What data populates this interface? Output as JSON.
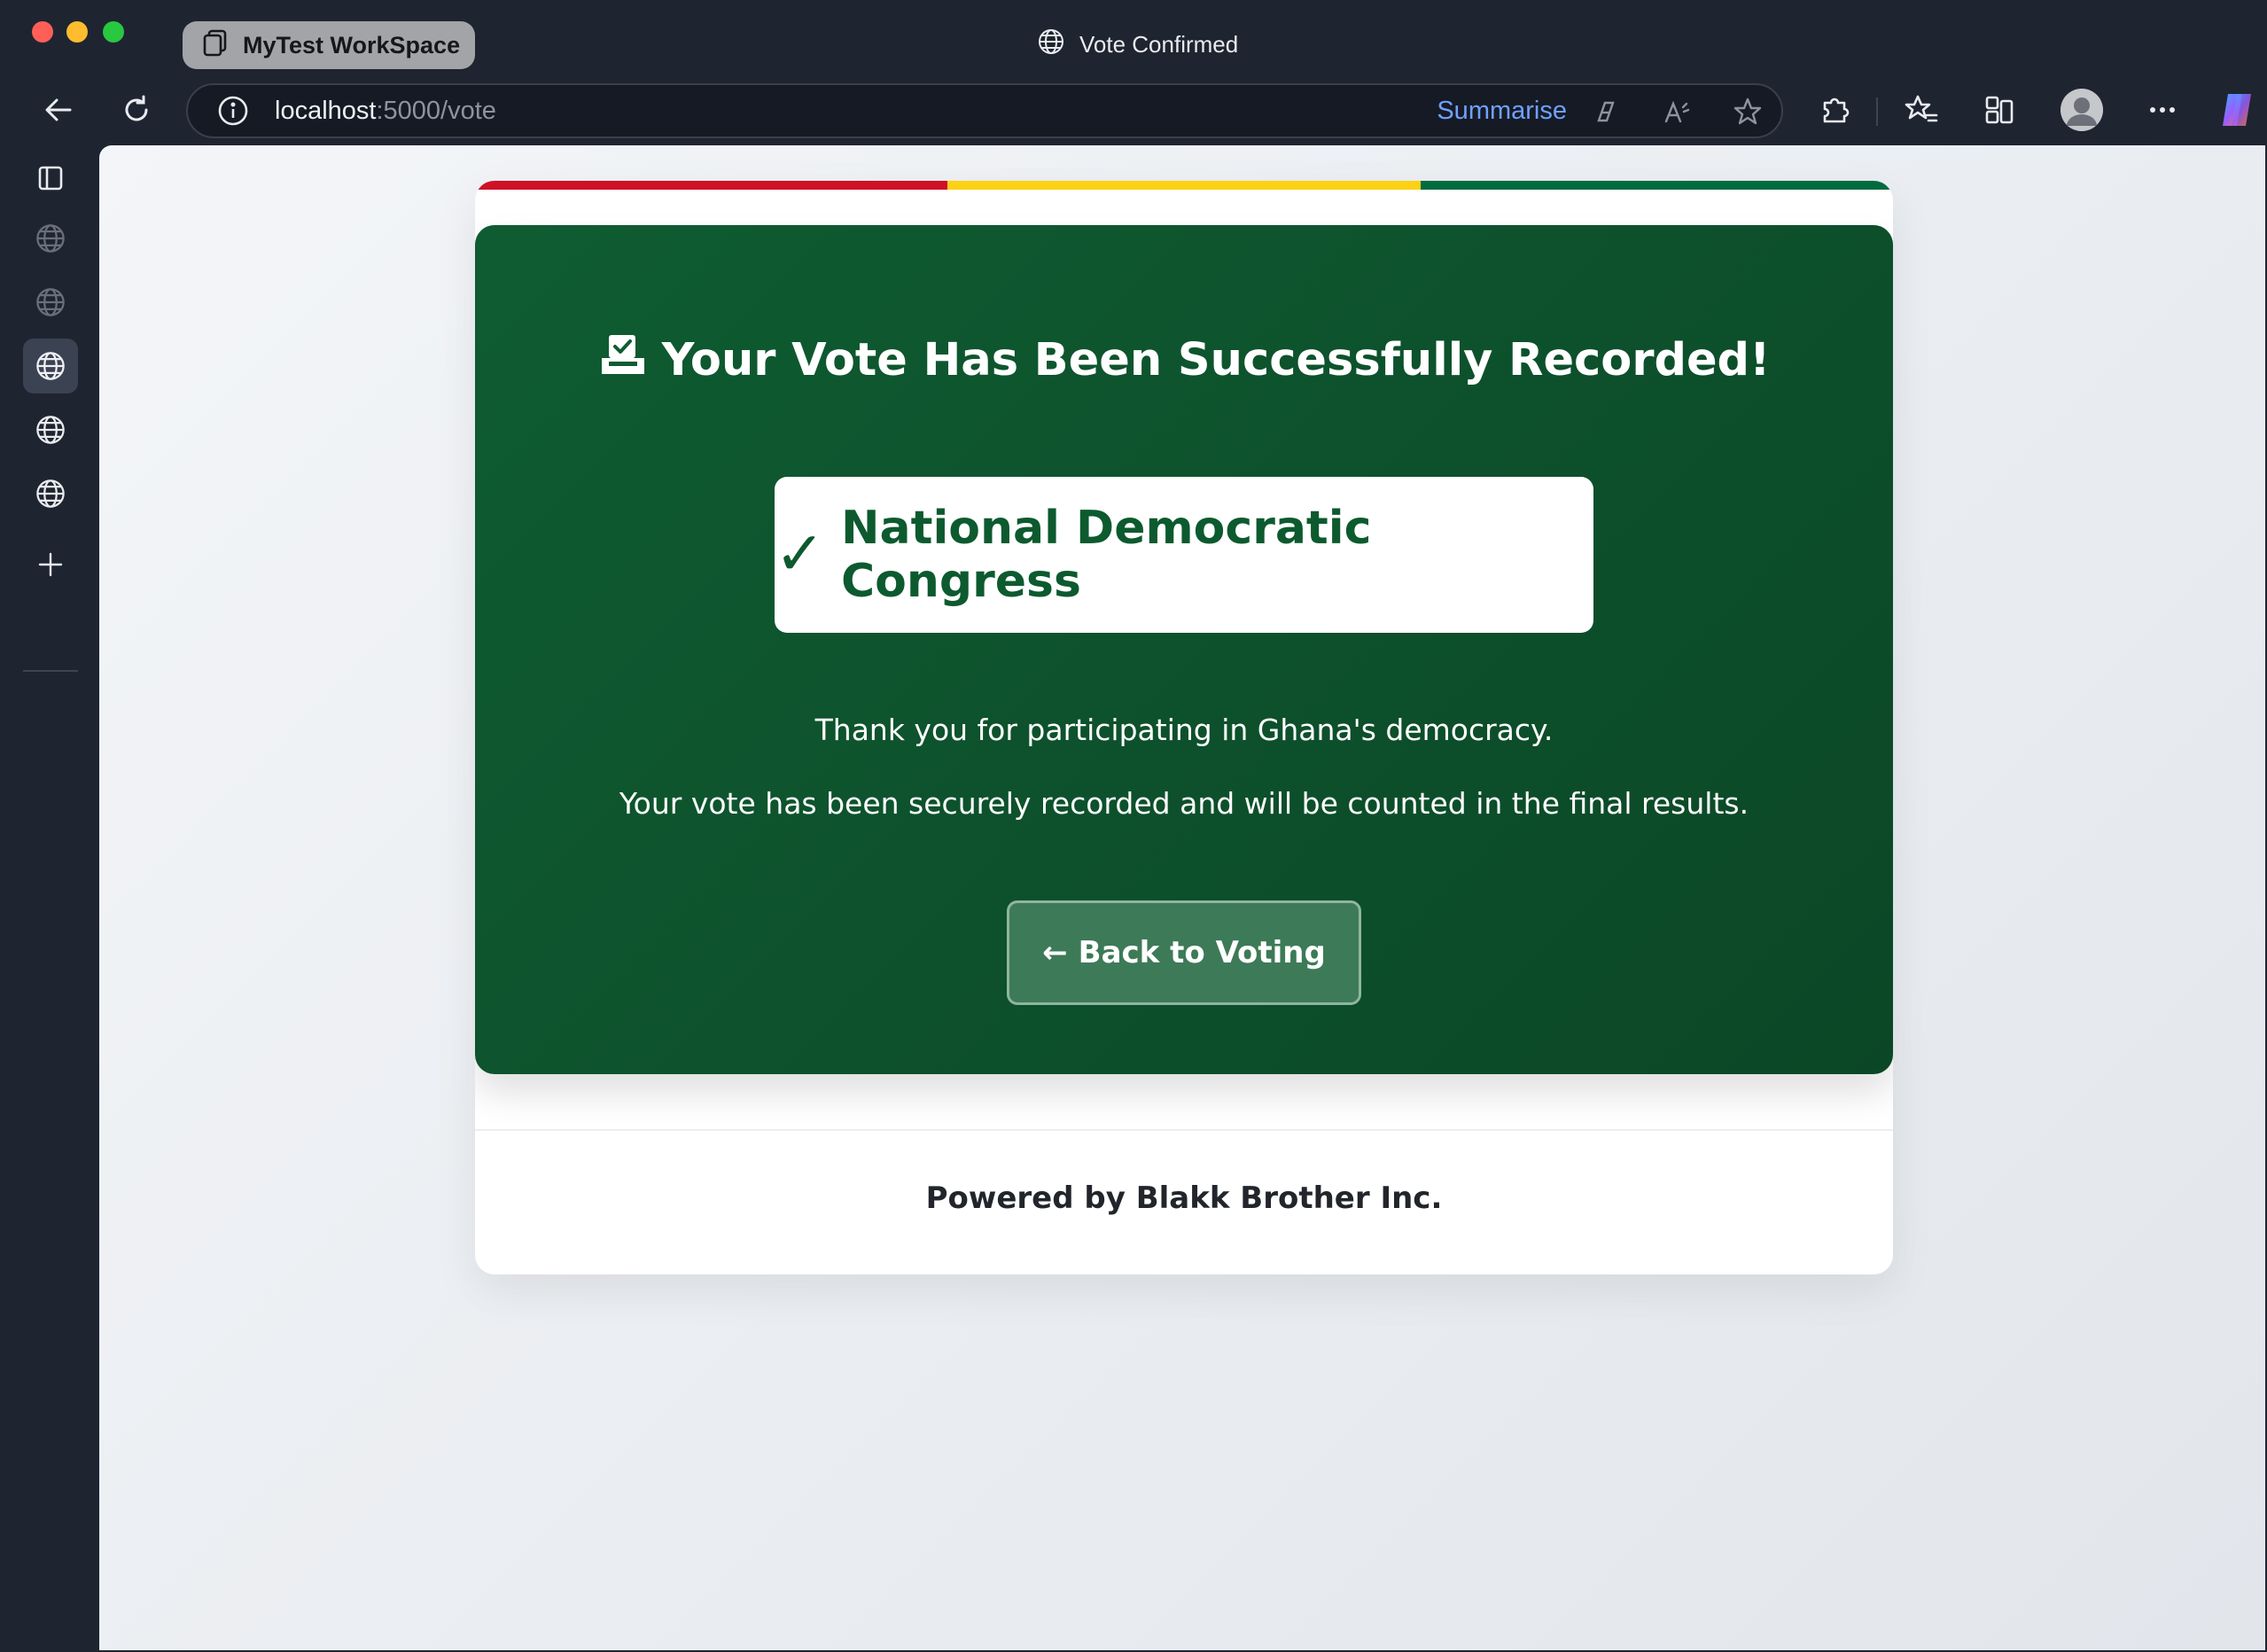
{
  "browser": {
    "workspace_label": "MyTest WorkSpace",
    "window_title": "Vote Confirmed",
    "address": {
      "host": "localhost",
      "path": ":5000/vote"
    },
    "summarise_label": "Summarise"
  },
  "icons": {
    "sidebar": [
      "tab-actions-icon",
      "globe-icon",
      "globe-icon",
      "globe-icon",
      "globe-icon",
      "globe-icon",
      "plus-icon"
    ],
    "toolbar": [
      "back-icon",
      "refresh-icon",
      "info-icon",
      "copilot-summarise-icon",
      "read-aloud-icon",
      "favorite-star-icon",
      "extensions-icon",
      "favorites-icon",
      "collections-icon",
      "profile-icon",
      "more-icon",
      "copilot-icon"
    ]
  },
  "page": {
    "flag_colors": [
      "#ce1126",
      "#fcd116",
      "#006b3f"
    ],
    "headline": "Your Vote Has Been Successfully Recorded!",
    "party_check": "✓",
    "party_name": "National Democratic Congress",
    "message_1": "Thank you for participating in Ghana's democracy.",
    "message_2": "Your vote has been securely recorded and will be counted in the final results.",
    "back_button_arrow": "←",
    "back_button_label": "Back to Voting",
    "footer": "Powered by Blakk Brother Inc."
  },
  "colors": {
    "panel_green": "#0f5c32",
    "accent_blue": "#6fa1ff"
  }
}
